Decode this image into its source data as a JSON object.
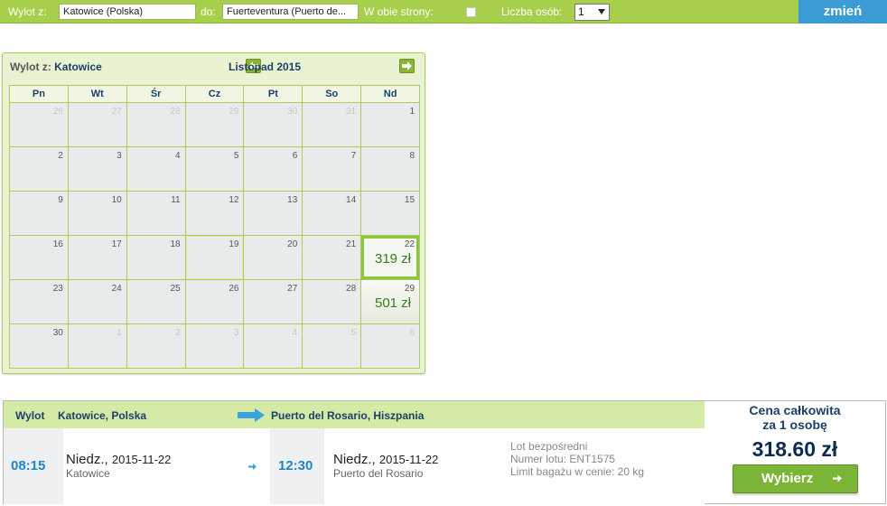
{
  "search": {
    "from_label": "Wylot z:",
    "from_value": "Katowice (Polska)",
    "to_label": "do:",
    "to_value": "Fuerteventura (Puerto de...",
    "roundtrip_label": "W obie strony:",
    "roundtrip_checked": false,
    "persons_label": "Liczba osób:",
    "persons_value": "1",
    "submit_label": "zmień"
  },
  "calendar": {
    "title_prefix": "Wylot z:",
    "title_city": "Katowice",
    "month": "Listopad 2015",
    "weekdays": [
      "Pn",
      "Wt",
      "Śr",
      "Cz",
      "Pt",
      "So",
      "Nd"
    ],
    "weeks": [
      [
        {
          "n": "26",
          "o": true
        },
        {
          "n": "27",
          "o": true
        },
        {
          "n": "28",
          "o": true
        },
        {
          "n": "29",
          "o": true
        },
        {
          "n": "30",
          "o": true
        },
        {
          "n": "31",
          "o": true
        },
        {
          "n": "1"
        }
      ],
      [
        {
          "n": "2"
        },
        {
          "n": "3"
        },
        {
          "n": "4"
        },
        {
          "n": "5"
        },
        {
          "n": "6"
        },
        {
          "n": "7"
        },
        {
          "n": "8"
        }
      ],
      [
        {
          "n": "9"
        },
        {
          "n": "10"
        },
        {
          "n": "11"
        },
        {
          "n": "12"
        },
        {
          "n": "13"
        },
        {
          "n": "14"
        },
        {
          "n": "15"
        }
      ],
      [
        {
          "n": "16"
        },
        {
          "n": "17"
        },
        {
          "n": "18"
        },
        {
          "n": "19",
          "h": true
        },
        {
          "n": "20"
        },
        {
          "n": "21"
        },
        {
          "n": "22",
          "p": "319 zł",
          "s": true
        }
      ],
      [
        {
          "n": "23"
        },
        {
          "n": "24"
        },
        {
          "n": "25"
        },
        {
          "n": "26"
        },
        {
          "n": "27"
        },
        {
          "n": "28"
        },
        {
          "n": "29",
          "p": "501 zł",
          "a": true
        }
      ],
      [
        {
          "n": "30"
        },
        {
          "n": "1",
          "o": true
        },
        {
          "n": "2",
          "o": true
        },
        {
          "n": "3",
          "o": true
        },
        {
          "n": "4",
          "o": true
        },
        {
          "n": "5",
          "o": true
        },
        {
          "n": "6",
          "o": true
        }
      ]
    ]
  },
  "flight": {
    "header_label": "Wylot",
    "from_city": "Katowice, Polska",
    "to_city": "Puerto del Rosario, Hiszpania",
    "departure_time": "08:15",
    "departure_day": "Niedz.,",
    "departure_date": "2015-11-22",
    "departure_city": "Katowice",
    "arrival_time": "12:30",
    "arrival_day": "Niedz.,",
    "arrival_date": "2015-11-22",
    "arrival_city": "Puerto del Rosario",
    "info_direct": "Lot bezpośredni",
    "info_flight_number": "Numer lotu: ENT1575",
    "info_baggage": "Limit bagażu w cenie: 20 kg"
  },
  "price": {
    "title_line1": "Cena całkowita",
    "title_line2": "za 1 osobę",
    "amount": "318.60 zł",
    "select_label": "Wybierz"
  },
  "colors": {
    "accent_green": "#a8cf4c",
    "button_blue": "#3a9bd5",
    "price_blue": "#0d2a55",
    "time_blue": "#1e86c7"
  }
}
